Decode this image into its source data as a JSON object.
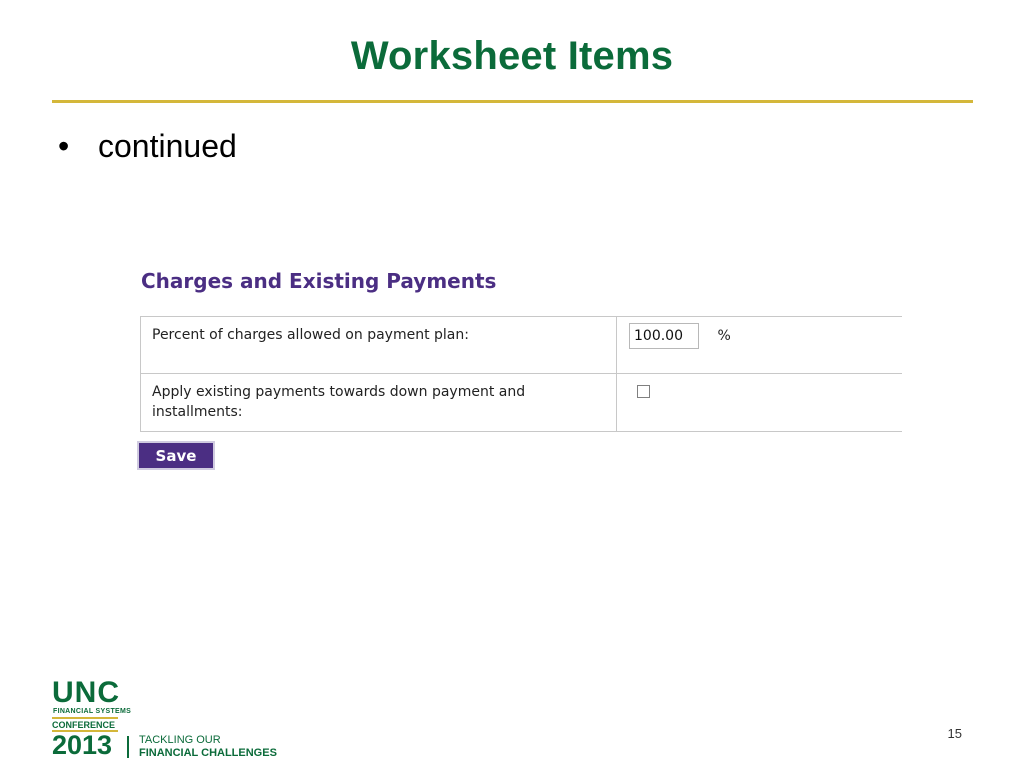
{
  "slide": {
    "title": "Worksheet Items",
    "bullet": "continued",
    "page_number": "15"
  },
  "panel": {
    "heading": "Charges and Existing Payments",
    "rows": [
      {
        "label": "Percent of charges allowed on payment plan:",
        "input_value": "100.00",
        "unit": "%"
      },
      {
        "label": "Apply existing payments towards down payment and installments:",
        "checked": false
      }
    ],
    "save_label": "Save"
  },
  "logo": {
    "name": "UNC",
    "subtitle": "FINANCIAL SYSTEMS",
    "event": "CONFERENCE",
    "year": "2013",
    "tagline_1": "TACKLING OUR",
    "tagline_2": "FINANCIAL CHALLENGES"
  },
  "colors": {
    "title_green": "#0b6b3a",
    "rule_gold": "#d4b73a",
    "brand_purple": "#4b2e83"
  }
}
